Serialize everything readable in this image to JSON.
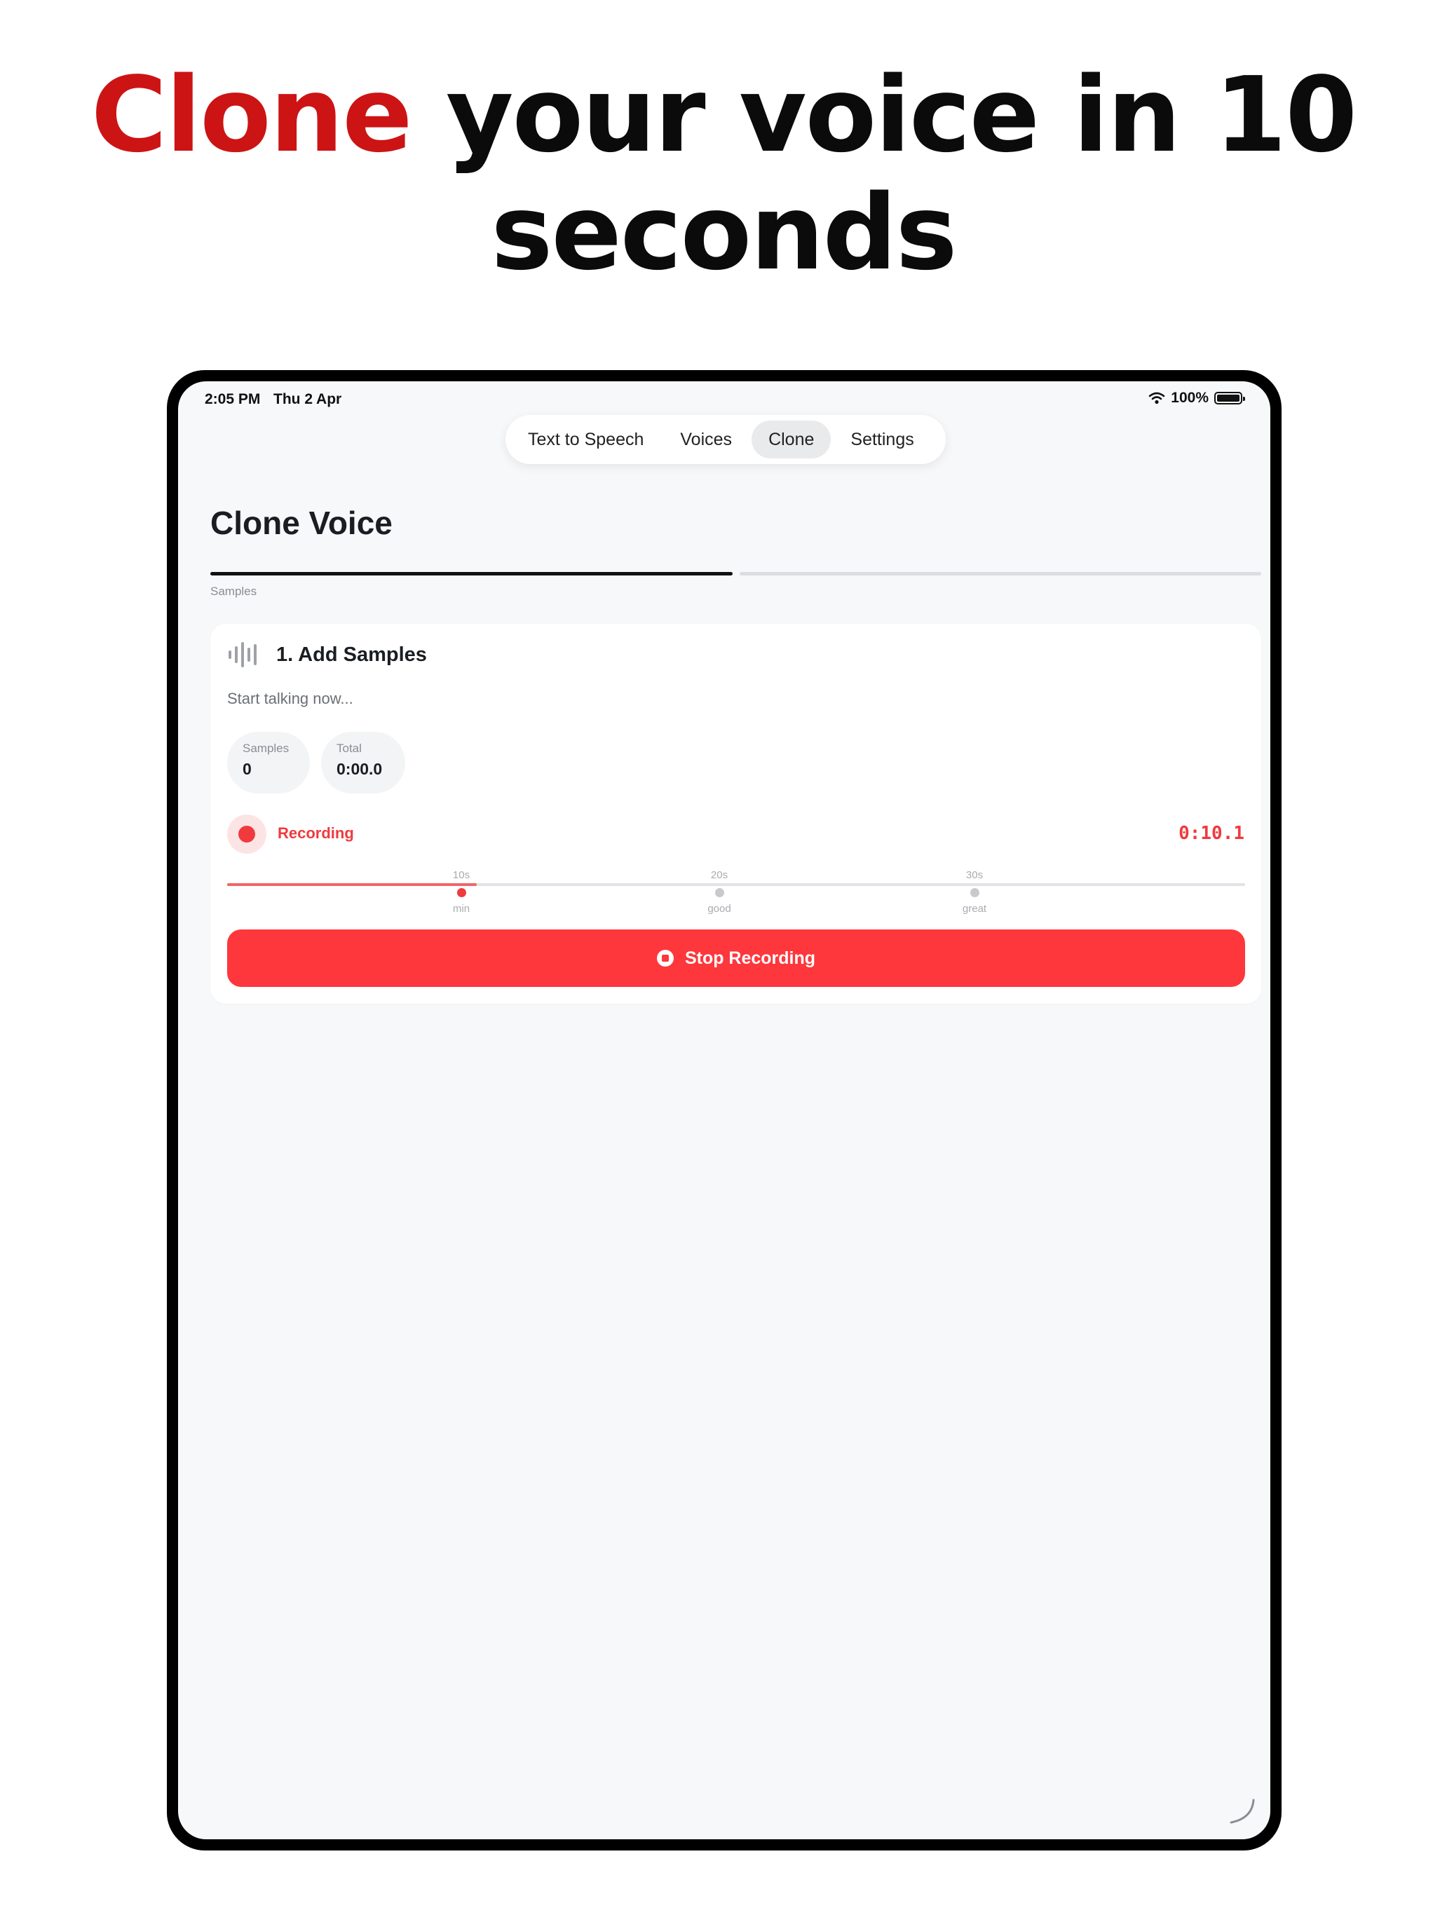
{
  "headline": {
    "accent": "Clone",
    "rest_line1": "your voice in 10",
    "line2": "seconds"
  },
  "colors": {
    "accent_red": "#cc1414",
    "record_red": "#fd373c",
    "background": "#f7f8fa"
  },
  "status_bar": {
    "time": "2:05 PM",
    "date": "Thu 2 Apr",
    "battery": "100%",
    "wifi_icon": "wifi-icon",
    "battery_icon": "battery-icon"
  },
  "tabs": [
    {
      "label": "Text to Speech",
      "active": false
    },
    {
      "label": "Voices",
      "active": false
    },
    {
      "label": "Clone",
      "active": true
    },
    {
      "label": "Settings",
      "active": false
    }
  ],
  "page": {
    "title": "Clone Voice",
    "step_label": "Samples"
  },
  "card": {
    "icon": "waveform-icon",
    "title": "1. Add Samples",
    "subtitle": "Start talking now...",
    "stats": [
      {
        "label": "Samples",
        "value": "0"
      },
      {
        "label": "Total",
        "value": "0:00.0"
      }
    ],
    "recording": {
      "label": "Recording",
      "timer": "0:10.1",
      "progress_fraction": 0.245
    },
    "markers": [
      {
        "top": "10s",
        "bottom": "min",
        "reached": true
      },
      {
        "top": "20s",
        "bottom": "good",
        "reached": false
      },
      {
        "top": "30s",
        "bottom": "great",
        "reached": false
      }
    ],
    "stop_button": {
      "label": "Stop Recording",
      "icon": "stop-icon"
    }
  }
}
